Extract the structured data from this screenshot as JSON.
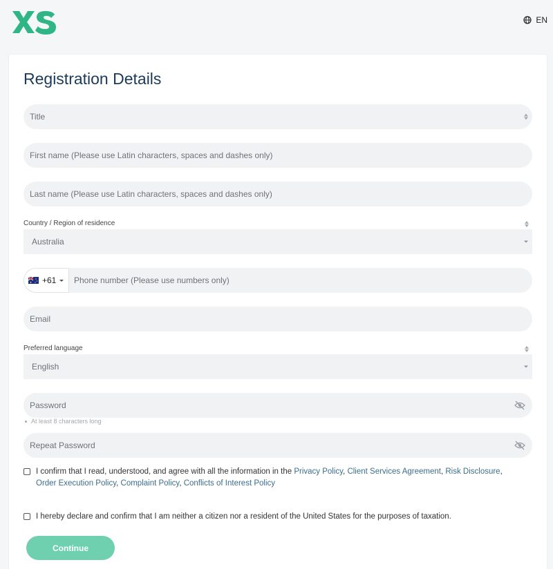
{
  "header": {
    "logo_text": "XS",
    "language": "EN",
    "brand_color": "#2fb586"
  },
  "form": {
    "title": "Registration Details",
    "title_placeholder": "Title",
    "first_name_placeholder": "First name (Please use Latin characters, spaces and dashes only)",
    "last_name_placeholder": "Last name (Please use Latin characters, spaces and dashes only)",
    "country_label": "Country / Region of residence",
    "country_value": "Australia",
    "phone_code": "+61",
    "phone_flag": "australia-flag",
    "phone_placeholder": "Phone number (Please use numbers only)",
    "email_placeholder": "Email",
    "language_label": "Preferred language",
    "language_value": "English",
    "password_placeholder": "Password",
    "password_hint": "At least 8 characters long",
    "repeat_password_placeholder": "Repeat Password",
    "confirm_text": "I confirm that I read, understood, and agree with all the information in the ",
    "links": {
      "privacy": "Privacy Policy",
      "client": "Client Services Agreement",
      "risk": "Risk Disclosure",
      "execution": "Order Execution Policy",
      "complaint": "Complaint Policy",
      "conflicts": "Conflicts of Interest Policy"
    },
    "separator": ", ",
    "declare_text": "I hereby declare and confirm that I am neither a citizen nor a resident of the United States for the purposes of taxation.",
    "continue_label": "Continue",
    "accent_color": "#6fd0b0",
    "link_color": "#3a6e8f"
  }
}
